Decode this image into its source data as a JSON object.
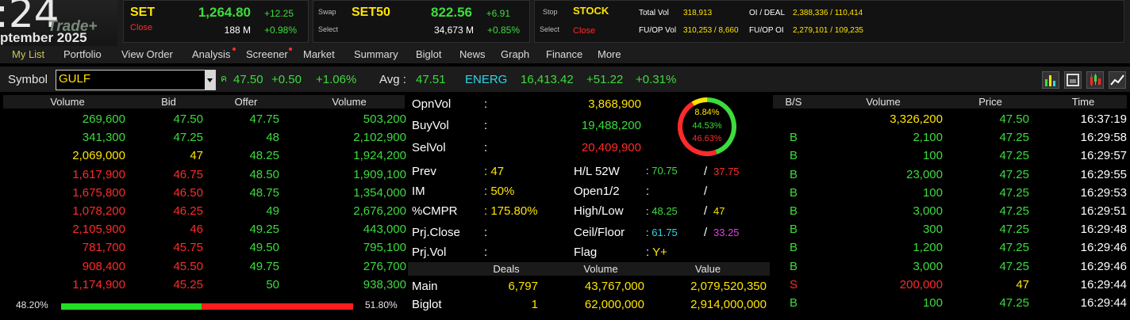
{
  "logo": {
    "clock": ":24",
    "brand": "Trade+",
    "market_date": "ptember 2025"
  },
  "indices": [
    {
      "name": "SET",
      "status": "Close",
      "value": "1,264.80",
      "volume": "188 M",
      "change": "+12.25",
      "percent": "+0.98%"
    },
    {
      "caption_top": "Swap",
      "caption_bottom": "Select",
      "name": "SET50",
      "value": "822.56",
      "volume": "34,673 M",
      "change": "+6.91",
      "percent": "+0.85%"
    }
  ],
  "stock_box": {
    "caption_top": "Stop",
    "caption_bottom": "Select",
    "name": "STOCK",
    "status": "Close",
    "total_vol_label": "Total Vol",
    "total_vol": "318,913",
    "oi_deal_label": "OI / DEAL",
    "oi_deal": "2,388,336 / 110,414",
    "fuop_vol_label": "FU/OP Vol",
    "fuop_vol": "310,253 / 8,660",
    "fuop_oi_label": "FU/OP OI",
    "fuop_oi": "2,279,101 / 109,235"
  },
  "menu": [
    "My List",
    "Portfolio",
    "View Order",
    "Analysis",
    "Screener",
    "Market",
    "Summary",
    "Biglot",
    "News",
    "Graph",
    "Finance",
    "More"
  ],
  "symbol_bar": {
    "label": "Symbol",
    "value": "GULF",
    "dropdown_icon": "triangle-down",
    "last": "47.50",
    "change": "+0.50",
    "percent": "+1.06%",
    "avg_label": "Avg :",
    "avg": "47.51",
    "sector": "ENERG",
    "sector_value": "16,413.42",
    "sector_change": "+51.22",
    "sector_percent": "+0.31%"
  },
  "bidoffer": {
    "headers": [
      "Volume",
      "Bid",
      "Offer",
      "Volume"
    ],
    "rows": [
      {
        "bid_vol": "269,600",
        "bid": "47.50",
        "offer": "47.75",
        "offer_vol": "503,200",
        "bc": "g",
        "oc": "g"
      },
      {
        "bid_vol": "341,300",
        "bid": "47.25",
        "offer": "48",
        "offer_vol": "2,102,900",
        "bc": "g",
        "oc": "g"
      },
      {
        "bid_vol": "2,069,000",
        "bid": "47",
        "offer": "48.25",
        "offer_vol": "1,924,200",
        "bc": "y",
        "oc": "g"
      },
      {
        "bid_vol": "1,617,900",
        "bid": "46.75",
        "offer": "48.50",
        "offer_vol": "1,909,100",
        "bc": "r",
        "oc": "g"
      },
      {
        "bid_vol": "1,675,800",
        "bid": "46.50",
        "offer": "48.75",
        "offer_vol": "1,354,000",
        "bc": "r",
        "oc": "g"
      },
      {
        "bid_vol": "1,078,200",
        "bid": "46.25",
        "offer": "49",
        "offer_vol": "2,676,200",
        "bc": "r",
        "oc": "g"
      },
      {
        "bid_vol": "2,105,900",
        "bid": "46",
        "offer": "49.25",
        "offer_vol": "443,000",
        "bc": "r",
        "oc": "g"
      },
      {
        "bid_vol": "781,700",
        "bid": "45.75",
        "offer": "49.50",
        "offer_vol": "795,100",
        "bc": "r",
        "oc": "g"
      },
      {
        "bid_vol": "908,400",
        "bid": "45.50",
        "offer": "49.75",
        "offer_vol": "276,700",
        "bc": "r",
        "oc": "g"
      },
      {
        "bid_vol": "1,174,900",
        "bid": "45.25",
        "offer": "50",
        "offer_vol": "938,300",
        "bc": "r",
        "oc": "g"
      }
    ],
    "bid_percent": "48.20%",
    "offer_percent": "51.80%",
    "bid_fraction": 0.482
  },
  "info": {
    "opnvol_label": "OpnVol",
    "opnvol": "3,868,900",
    "buyvol_label": "BuyVol",
    "buyvol": "19,488,200",
    "selvol_label": "SelVol",
    "selvol": "20,409,900",
    "gauge": {
      "top": "8.84%",
      "mid": "44.53%",
      "bot": "46.63%",
      "fractions": [
        0.0884,
        0.4453,
        0.4663
      ]
    },
    "prev_label": "Prev",
    "prev": "47",
    "im_label": "IM",
    "im": "50%",
    "cmpr_label": "%CMPR",
    "cmpr": "175.80%",
    "prjclose_label": "Prj.Close",
    "prjvol_label": "Prj.Vol",
    "hl52_label": "H/L 52W",
    "hl52_high": "70.75",
    "hl52_low": "37.75",
    "open_label": "Open1/2",
    "highlow_label": "High/Low",
    "high": "48.25",
    "low": "47",
    "ceilfloor_label": "Ceil/Floor",
    "ceil": "61.75",
    "floor": "33.25",
    "flag_label": "Flag",
    "flag": "Y+",
    "colon": ":",
    "slash": "/"
  },
  "deals": {
    "headers": [
      "Deals",
      "Volume",
      "Value"
    ],
    "rows": [
      {
        "label": "Main",
        "deals": "6,797",
        "volume": "43,767,000",
        "value": "2,079,520,350"
      },
      {
        "label": "Biglot",
        "deals": "1",
        "volume": "62,000,000",
        "value": "2,914,000,000"
      }
    ]
  },
  "ticks": {
    "headers": [
      "B/S",
      "Volume",
      "Price",
      "Time"
    ],
    "rows": [
      {
        "side": "",
        "vol": "3,326,200",
        "price": "47.50",
        "time": "16:37:19",
        "vc": "y",
        "pc": "g",
        "sc": "g"
      },
      {
        "side": "B",
        "vol": "2,100",
        "price": "47.25",
        "time": "16:29:58",
        "vc": "g",
        "pc": "g",
        "sc": "g"
      },
      {
        "side": "B",
        "vol": "100",
        "price": "47.25",
        "time": "16:29:57",
        "vc": "g",
        "pc": "g",
        "sc": "g"
      },
      {
        "side": "B",
        "vol": "23,000",
        "price": "47.25",
        "time": "16:29:55",
        "vc": "g",
        "pc": "g",
        "sc": "g"
      },
      {
        "side": "B",
        "vol": "100",
        "price": "47.25",
        "time": "16:29:53",
        "vc": "g",
        "pc": "g",
        "sc": "g"
      },
      {
        "side": "B",
        "vol": "3,000",
        "price": "47.25",
        "time": "16:29:51",
        "vc": "g",
        "pc": "g",
        "sc": "g"
      },
      {
        "side": "B",
        "vol": "300",
        "price": "47.25",
        "time": "16:29:48",
        "vc": "g",
        "pc": "g",
        "sc": "g"
      },
      {
        "side": "B",
        "vol": "1,200",
        "price": "47.25",
        "time": "16:29:46",
        "vc": "g",
        "pc": "g",
        "sc": "g"
      },
      {
        "side": "B",
        "vol": "3,000",
        "price": "47.25",
        "time": "16:29:46",
        "vc": "g",
        "pc": "g",
        "sc": "g"
      },
      {
        "side": "S",
        "vol": "200,000",
        "price": "47",
        "time": "16:29:44",
        "vc": "r",
        "pc": "y",
        "sc": "r"
      },
      {
        "side": "B",
        "vol": "100",
        "price": "47.25",
        "time": "16:29:44",
        "vc": "g",
        "pc": "g",
        "sc": "g"
      }
    ]
  }
}
